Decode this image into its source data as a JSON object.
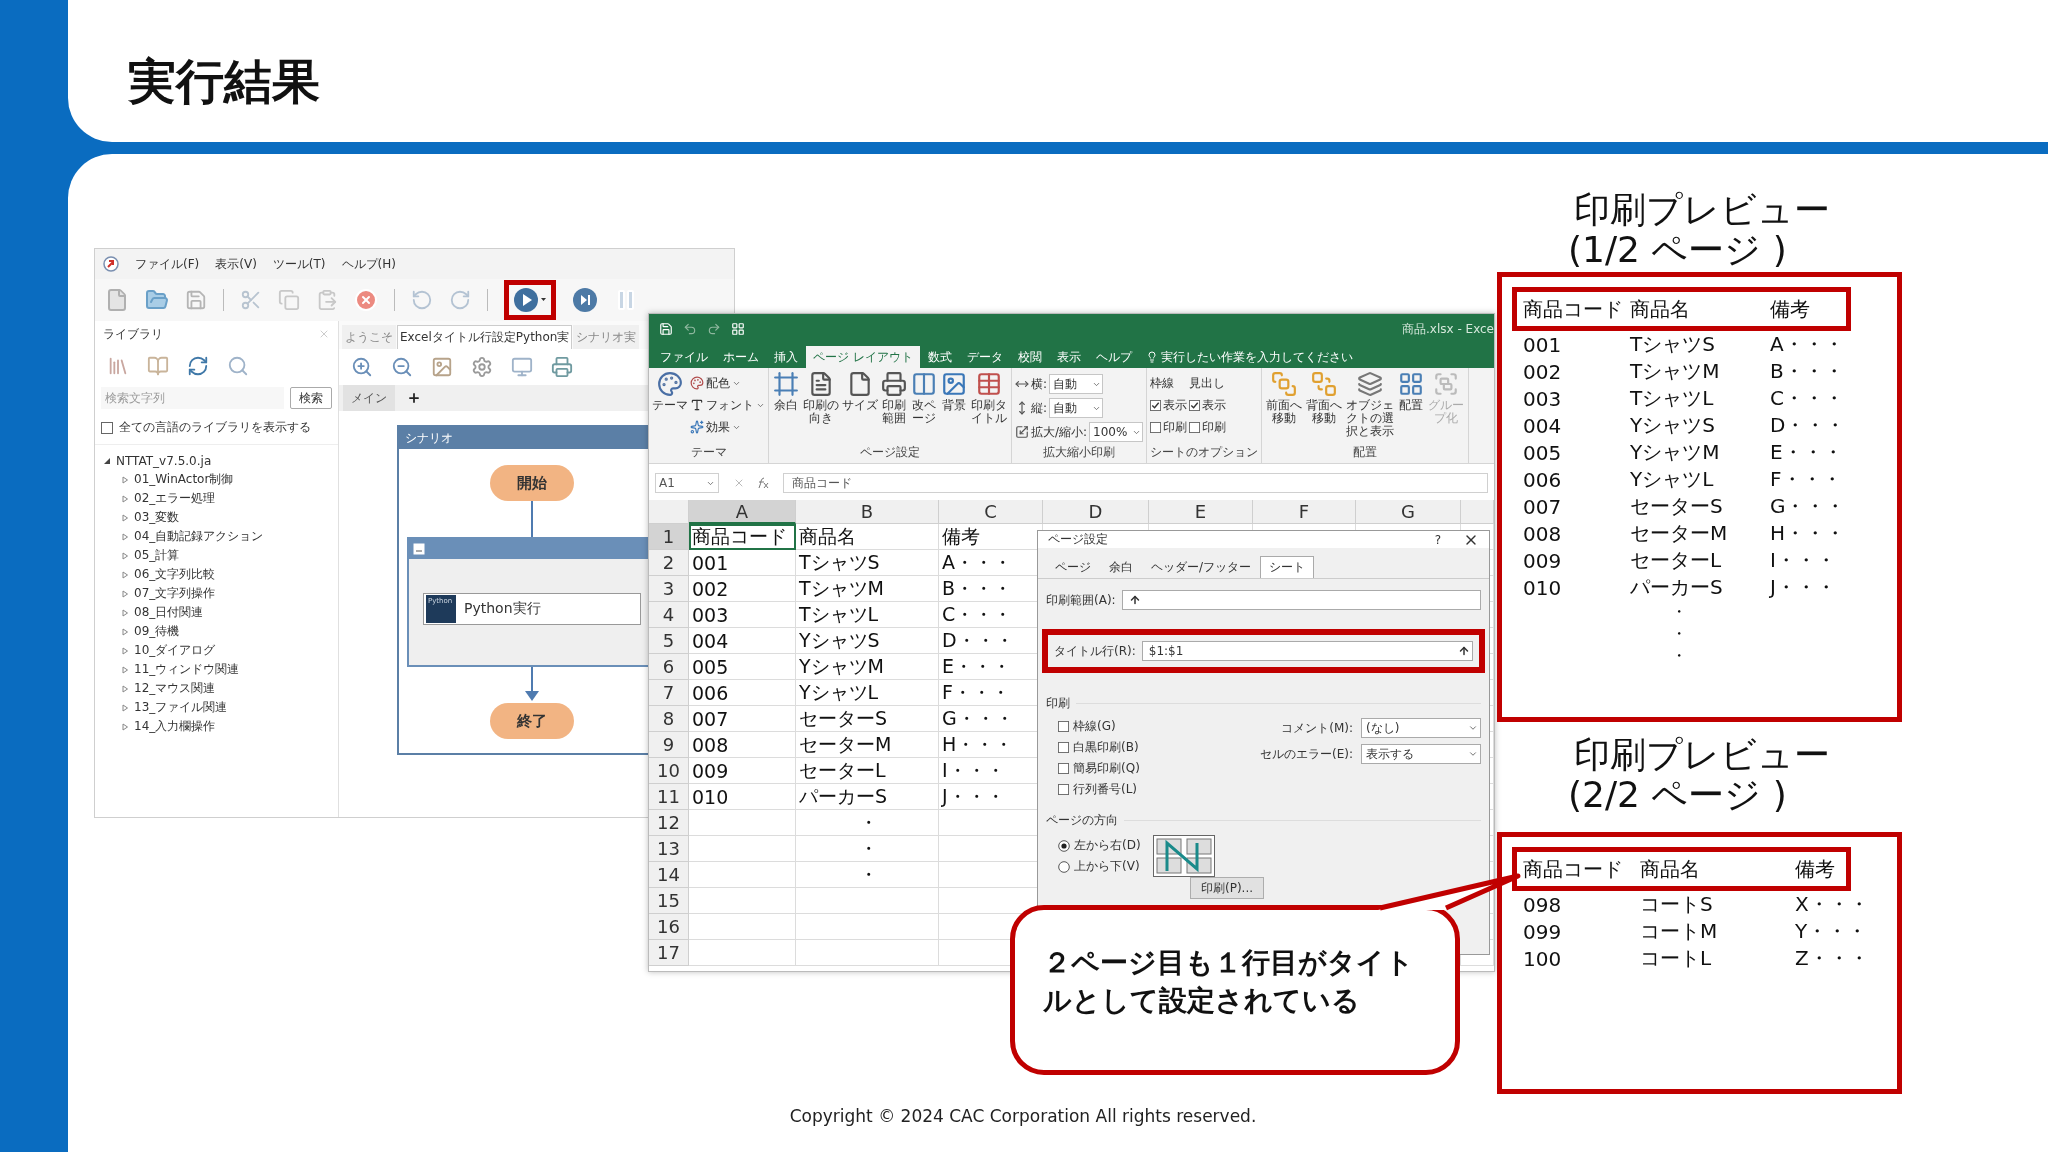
{
  "slide": {
    "title": "実行結果",
    "copyright": "Copyright © 2024 CAC Corporation All rights reserved."
  },
  "winactor": {
    "menu": [
      "ファイル(F)",
      "表示(V)",
      "ツール(T)",
      "ヘルプ(H)"
    ],
    "library": {
      "title": "ライブラリ",
      "search": {
        "placeholder": "検索文字列",
        "button": "検索"
      },
      "show_all": {
        "label": "全ての言語のライブラリを表示する",
        "checked": false
      },
      "tree": [
        {
          "label": "NTTAT_v7.5.0.ja",
          "expanded": true,
          "children": [
            {
              "label": "01_WinActor制御",
              "expanded": false
            },
            {
              "label": "02_エラー処理",
              "expanded": false
            },
            {
              "label": "03_変数",
              "expanded": false
            },
            {
              "label": "04_自動記録アクション",
              "expanded": false
            },
            {
              "label": "05_計算",
              "expanded": false
            },
            {
              "label": "06_文字列比較",
              "expanded": false
            },
            {
              "label": "07_文字列操作",
              "expanded": false
            },
            {
              "label": "08_日付関連",
              "expanded": false
            },
            {
              "label": "09_待機",
              "expanded": false
            },
            {
              "label": "10_ダイアログ",
              "expanded": false
            },
            {
              "label": "11_ウィンドウ関連",
              "expanded": false
            },
            {
              "label": "12_マウス関連",
              "expanded": false
            },
            {
              "label": "13_ファイル関連",
              "expanded": false
            },
            {
              "label": "14_入力欄操作",
              "expanded": false
            }
          ]
        }
      ]
    },
    "tabs": [
      {
        "label": "ようこそ",
        "selected": false
      },
      {
        "label": "Excelタイトル行設定Python実",
        "selected": true
      },
      {
        "label": "シナリオ実",
        "selected": false
      }
    ],
    "sheet_tabs": [
      {
        "label": "メイン",
        "selected": true
      }
    ],
    "scenario": {
      "title": "シナリオ",
      "start": "開始",
      "node": {
        "badge": "Python",
        "label": "Python実行"
      },
      "end": "終了"
    }
  },
  "excel": {
    "title": "商品.xlsx - Exce",
    "tabs": [
      {
        "label": "ファイル",
        "selected": false
      },
      {
        "label": "ホーム",
        "selected": false
      },
      {
        "label": "挿入",
        "selected": false
      },
      {
        "label": "ページ レイアウト",
        "selected": true
      },
      {
        "label": "数式",
        "selected": false
      },
      {
        "label": "データ",
        "selected": false
      },
      {
        "label": "校閲",
        "selected": false
      },
      {
        "label": "表示",
        "selected": false
      },
      {
        "label": "ヘルプ",
        "selected": false
      }
    ],
    "tell_me": "実行したい作業を入力してください",
    "ribbon": [
      {
        "label": "テーマ",
        "columns": [
          [
            {
              "kind": "small",
              "label": "配色"
            },
            {
              "kind": "small",
              "label": "フォント"
            },
            {
              "kind": "small",
              "label": "効果"
            }
          ],
          [
            {
              "kind": "large",
              "label": "テーマ"
            }
          ]
        ]
      },
      {
        "label": "ページ設定",
        "columns": [
          [
            {
              "kind": "large",
              "label": "余白"
            }
          ],
          [
            {
              "kind": "large",
              "label": "印刷の向き"
            }
          ],
          [
            {
              "kind": "large",
              "label": "サイズ"
            }
          ],
          [
            {
              "kind": "large",
              "label": "印刷範囲"
            }
          ],
          [
            {
              "kind": "large",
              "label": "改ページ"
            }
          ],
          [
            {
              "kind": "large",
              "label": "背景"
            }
          ],
          [
            {
              "kind": "large",
              "label": "印刷タイトル"
            }
          ]
        ]
      },
      {
        "label": "拡大縮小印刷",
        "columns": [
          [
            {
              "kind": "field",
              "label": "横:",
              "value": "自動"
            },
            {
              "kind": "field",
              "label": "縦:",
              "value": "自動"
            },
            {
              "kind": "spin",
              "label": "拡大/縮小:",
              "value": "100%"
            }
          ]
        ]
      },
      {
        "label": "シートのオプション",
        "columns": [
          [
            {
              "kind": "heading",
              "label": "枠線"
            },
            {
              "kind": "check",
              "label": "表示",
              "checked": true
            },
            {
              "kind": "check",
              "label": "印刷",
              "checked": false
            }
          ],
          [
            {
              "kind": "heading",
              "label": "見出し"
            },
            {
              "kind": "check",
              "label": "表示",
              "checked": true
            },
            {
              "kind": "check",
              "label": "印刷",
              "checked": false
            }
          ]
        ]
      },
      {
        "label": "配置",
        "columns": [
          [
            {
              "kind": "large",
              "label": "前面へ移動",
              "disabled": false
            }
          ],
          [
            {
              "kind": "large",
              "label": "背面へ移動",
              "disabled": false
            }
          ],
          [
            {
              "kind": "large",
              "label": "オブジェクトの選択と表示",
              "disabled": false
            }
          ],
          [
            {
              "kind": "large",
              "label": "配置",
              "disabled": false
            }
          ],
          [
            {
              "kind": "large",
              "label": "グループ化",
              "disabled": true
            }
          ]
        ]
      }
    ],
    "name_box": "A1",
    "formula": "商品コード",
    "columns": [
      "A",
      "B",
      "C",
      "D",
      "E",
      "F",
      "G"
    ],
    "rows": [
      {
        "number": "1",
        "cells": {
          "A": "商品コード",
          "B": "商品名",
          "C": "備考"
        }
      },
      {
        "number": "2",
        "cells": {
          "A": "001",
          "B": "TシャツS",
          "C": "A・・・"
        }
      },
      {
        "number": "3",
        "cells": {
          "A": "002",
          "B": "TシャツM",
          "C": "B・・・"
        }
      },
      {
        "number": "4",
        "cells": {
          "A": "003",
          "B": "TシャツL",
          "C": "C・・・"
        }
      },
      {
        "number": "5",
        "cells": {
          "A": "004",
          "B": "YシャツS",
          "C": "D・・・"
        }
      },
      {
        "number": "6",
        "cells": {
          "A": "005",
          "B": "YシャツM",
          "C": "E・・・"
        }
      },
      {
        "number": "7",
        "cells": {
          "A": "006",
          "B": "YシャツL",
          "C": "F・・・"
        }
      },
      {
        "number": "8",
        "cells": {
          "A": "007",
          "B": "セーターS",
          "C": "G・・・"
        }
      },
      {
        "number": "9",
        "cells": {
          "A": "008",
          "B": "セーターM",
          "C": "H・・・"
        }
      },
      {
        "number": "10",
        "cells": {
          "A": "009",
          "B": "セーターL",
          "C": "I・・・"
        }
      },
      {
        "number": "11",
        "cells": {
          "A": "010",
          "B": "パーカーS",
          "C": "J・・・"
        }
      },
      {
        "number": "12",
        "cells": {
          "B": "・"
        }
      },
      {
        "number": "13",
        "cells": {
          "B": "・"
        }
      },
      {
        "number": "14",
        "cells": {
          "B": "・"
        }
      },
      {
        "number": "15"
      },
      {
        "number": "16"
      },
      {
        "number": "17"
      }
    ]
  },
  "dialog": {
    "title": "ページ設定",
    "help": "?",
    "tabs": [
      {
        "label": "ページ",
        "selected": false
      },
      {
        "label": "余白",
        "selected": false
      },
      {
        "label": "ヘッダー/フッター",
        "selected": false
      },
      {
        "label": "シート",
        "selected": true
      }
    ],
    "print_area": {
      "label": "印刷範囲(A):"
    },
    "title_rows": {
      "label": "タイトル行(R):",
      "value": "$1:$1"
    },
    "print": {
      "heading": "印刷",
      "options": [
        {
          "label": "枠線(G)",
          "checked": false
        },
        {
          "label": "白黒印刷(B)",
          "checked": false
        },
        {
          "label": "簡易印刷(Q)",
          "checked": false
        },
        {
          "label": "行列番号(L)",
          "checked": false
        }
      ],
      "comment": {
        "label": "コメント(M):",
        "value": "(なし)"
      },
      "cell_errors": {
        "label": "セルのエラー(E):",
        "value": "表示する"
      }
    },
    "page_order": {
      "heading": "ページの方向",
      "options": [
        {
          "label": "左から右(D)",
          "selected": true
        },
        {
          "label": "上から下(V)",
          "selected": false
        }
      ]
    },
    "buttons": [
      "印刷(P)..."
    ]
  },
  "previews": [
    {
      "title": "印刷プレビュー",
      "subtitle": "(1/2 ページ )",
      "header": [
        "商品コード",
        "商品名",
        "備考"
      ],
      "rows": [
        [
          "001",
          "TシャツS",
          "A・・・"
        ],
        [
          "002",
          "TシャツM",
          "B・・・"
        ],
        [
          "003",
          "TシャツL",
          "C・・・"
        ],
        [
          "004",
          "YシャツS",
          "D・・・"
        ],
        [
          "005",
          "YシャツM",
          "E・・・"
        ],
        [
          "006",
          "YシャツL",
          "F・・・"
        ],
        [
          "007",
          "セーターS",
          "G・・・"
        ],
        [
          "008",
          "セーターM",
          "H・・・"
        ],
        [
          "009",
          "セーターL",
          "I・・・"
        ],
        [
          "010",
          "パーカーS",
          "J・・・"
        ]
      ],
      "ellipsis": [
        "・",
        "・",
        "・"
      ]
    },
    {
      "title": "印刷プレビュー",
      "subtitle": "(2/2 ページ )",
      "header": [
        "商品コード",
        "商品名",
        "備考"
      ],
      "rows": [
        [
          "098",
          "コートS",
          "X・・・"
        ],
        [
          "099",
          "コートM",
          "Y・・・"
        ],
        [
          "100",
          "コートL",
          "Z・・・"
        ]
      ]
    }
  ],
  "callout": {
    "text": "２ページ目も１行目がタイトルとして設定されている"
  }
}
